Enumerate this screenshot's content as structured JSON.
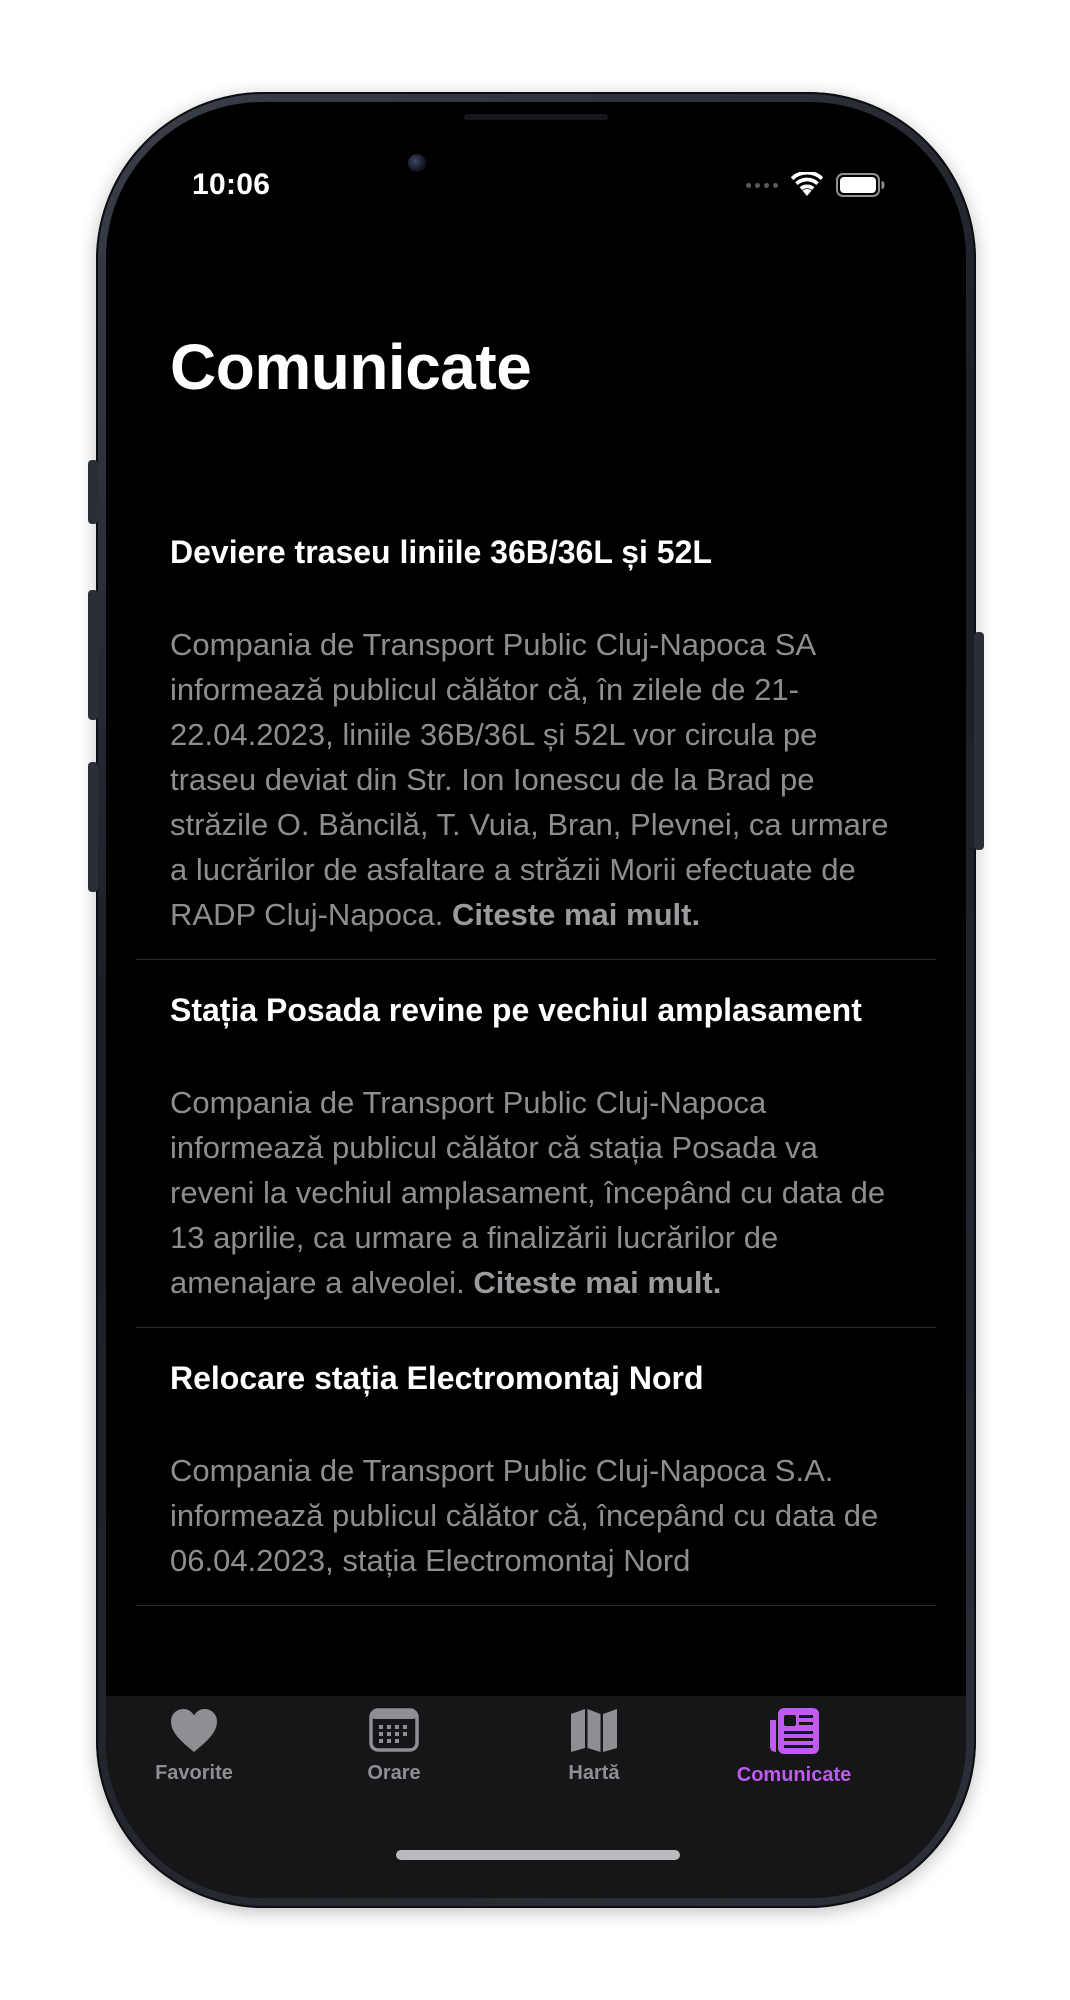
{
  "status_bar": {
    "time": "10:06"
  },
  "page": {
    "title": "Comunicate"
  },
  "articles": [
    {
      "title": "Deviere traseu liniile 36B/36L și 52L",
      "body": "Compania de Transport Public Cluj-Napoca SA informează publicul călător că, în zilele de 21-22.04.2023, liniile 36B/36L și 52L vor circula pe traseu deviat din Str. Ion Ionescu de la Brad pe străzile O. Băncilă, T. Vuia, Bran, Plevnei,  ca urmare a lucrărilor de asfaltare a străzii Morii efectuate de RADP Cluj-Napoca.",
      "read_more": "Citeste mai mult."
    },
    {
      "title": "Stația Posada revine pe vechiul amplasament",
      "body": "Compania de Transport Public Cluj-Napoca informează publicul călător că stația Posada va reveni la vechiul amplasament, începând cu data de 13 aprilie, ca urmare a finalizării lucrărilor de amenajare a alveolei.",
      "read_more": "Citeste mai mult."
    },
    {
      "title": "Relocare stația Electromontaj Nord",
      "body": "Compania de Transport Public Cluj-Napoca S.A. informează publicul călător că, începând cu data de 06.04.2023, stația Electromontaj Nord",
      "read_more": ""
    }
  ],
  "tab_bar": {
    "active_color": "#bf5af2",
    "inactive_color": "#8e8e93",
    "tabs": [
      {
        "label": "Favorite",
        "icon": "heart-icon",
        "active": false
      },
      {
        "label": "Orare",
        "icon": "calendar-icon",
        "active": false
      },
      {
        "label": "Hartă",
        "icon": "map-icon",
        "active": false
      },
      {
        "label": "Comunicate",
        "icon": "newspaper-icon",
        "active": true
      }
    ]
  }
}
